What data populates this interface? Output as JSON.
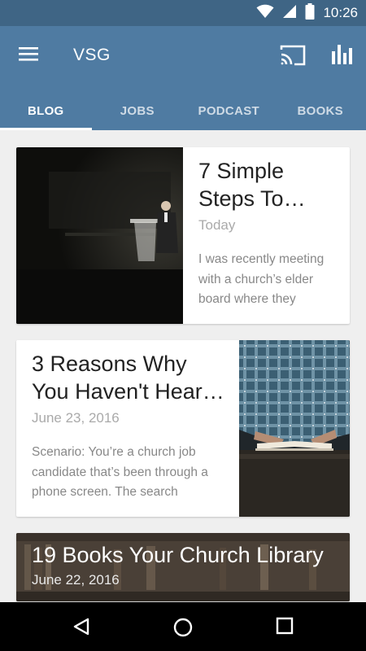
{
  "status_bar": {
    "time": "10:26",
    "icons": [
      "wifi-icon",
      "cellular-signal-icon",
      "battery-icon"
    ]
  },
  "app_bar": {
    "title": "VSG",
    "icons": [
      "menu-icon",
      "cast-icon",
      "stats-icon"
    ],
    "color": "#4f7ba2"
  },
  "tabs": [
    {
      "label": "BLOG",
      "active": true
    },
    {
      "label": "JOBS",
      "active": false
    },
    {
      "label": "PODCAST",
      "active": false
    },
    {
      "label": "BOOKS",
      "active": false
    }
  ],
  "posts": [
    {
      "title": "7 Simple Steps To…",
      "date": "Today",
      "excerpt": "I was recently meeting with a church’s elder board where they",
      "image_alt": "speaker at a podium on a dark stage"
    },
    {
      "title": "3 Reasons Why You Haven't Hear…",
      "date": "June 23, 2016",
      "excerpt": "Scenario: You’re a church job candidate that’s been through a phone screen. The search",
      "image_alt": "person in plaid shirt with an open book"
    },
    {
      "title": "19 Books Your Church Library",
      "date": "June 22, 2016",
      "image_alt": "bookshelves"
    }
  ],
  "nav_bar": {
    "icons": [
      "back-icon",
      "home-icon",
      "recents-icon"
    ]
  }
}
